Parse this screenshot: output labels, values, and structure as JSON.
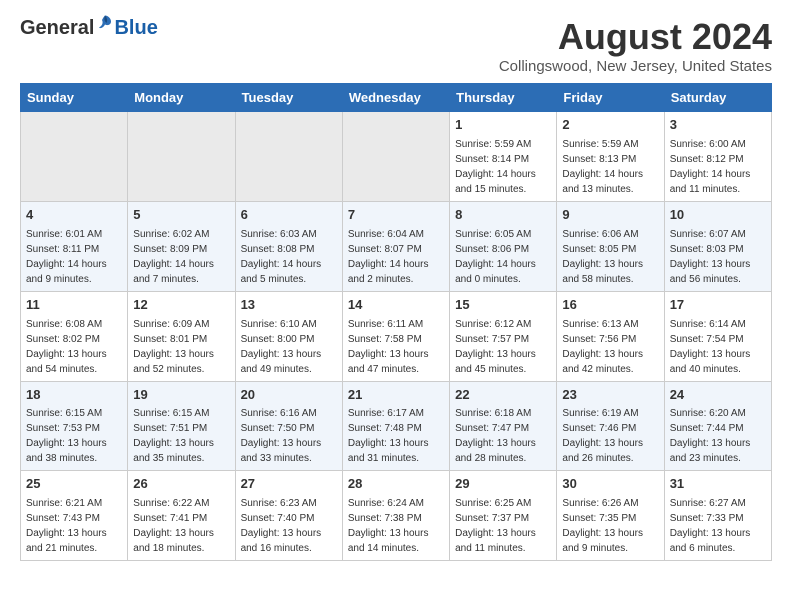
{
  "header": {
    "logo_general": "General",
    "logo_blue": "Blue",
    "month_title": "August 2024",
    "location": "Collingswood, New Jersey, United States"
  },
  "weekdays": [
    "Sunday",
    "Monday",
    "Tuesday",
    "Wednesday",
    "Thursday",
    "Friday",
    "Saturday"
  ],
  "weeks": [
    [
      {
        "day": "",
        "info": ""
      },
      {
        "day": "",
        "info": ""
      },
      {
        "day": "",
        "info": ""
      },
      {
        "day": "",
        "info": ""
      },
      {
        "day": "1",
        "info": "Sunrise: 5:59 AM\nSunset: 8:14 PM\nDaylight: 14 hours\nand 15 minutes."
      },
      {
        "day": "2",
        "info": "Sunrise: 5:59 AM\nSunset: 8:13 PM\nDaylight: 14 hours\nand 13 minutes."
      },
      {
        "day": "3",
        "info": "Sunrise: 6:00 AM\nSunset: 8:12 PM\nDaylight: 14 hours\nand 11 minutes."
      }
    ],
    [
      {
        "day": "4",
        "info": "Sunrise: 6:01 AM\nSunset: 8:11 PM\nDaylight: 14 hours\nand 9 minutes."
      },
      {
        "day": "5",
        "info": "Sunrise: 6:02 AM\nSunset: 8:09 PM\nDaylight: 14 hours\nand 7 minutes."
      },
      {
        "day": "6",
        "info": "Sunrise: 6:03 AM\nSunset: 8:08 PM\nDaylight: 14 hours\nand 5 minutes."
      },
      {
        "day": "7",
        "info": "Sunrise: 6:04 AM\nSunset: 8:07 PM\nDaylight: 14 hours\nand 2 minutes."
      },
      {
        "day": "8",
        "info": "Sunrise: 6:05 AM\nSunset: 8:06 PM\nDaylight: 14 hours\nand 0 minutes."
      },
      {
        "day": "9",
        "info": "Sunrise: 6:06 AM\nSunset: 8:05 PM\nDaylight: 13 hours\nand 58 minutes."
      },
      {
        "day": "10",
        "info": "Sunrise: 6:07 AM\nSunset: 8:03 PM\nDaylight: 13 hours\nand 56 minutes."
      }
    ],
    [
      {
        "day": "11",
        "info": "Sunrise: 6:08 AM\nSunset: 8:02 PM\nDaylight: 13 hours\nand 54 minutes."
      },
      {
        "day": "12",
        "info": "Sunrise: 6:09 AM\nSunset: 8:01 PM\nDaylight: 13 hours\nand 52 minutes."
      },
      {
        "day": "13",
        "info": "Sunrise: 6:10 AM\nSunset: 8:00 PM\nDaylight: 13 hours\nand 49 minutes."
      },
      {
        "day": "14",
        "info": "Sunrise: 6:11 AM\nSunset: 7:58 PM\nDaylight: 13 hours\nand 47 minutes."
      },
      {
        "day": "15",
        "info": "Sunrise: 6:12 AM\nSunset: 7:57 PM\nDaylight: 13 hours\nand 45 minutes."
      },
      {
        "day": "16",
        "info": "Sunrise: 6:13 AM\nSunset: 7:56 PM\nDaylight: 13 hours\nand 42 minutes."
      },
      {
        "day": "17",
        "info": "Sunrise: 6:14 AM\nSunset: 7:54 PM\nDaylight: 13 hours\nand 40 minutes."
      }
    ],
    [
      {
        "day": "18",
        "info": "Sunrise: 6:15 AM\nSunset: 7:53 PM\nDaylight: 13 hours\nand 38 minutes."
      },
      {
        "day": "19",
        "info": "Sunrise: 6:15 AM\nSunset: 7:51 PM\nDaylight: 13 hours\nand 35 minutes."
      },
      {
        "day": "20",
        "info": "Sunrise: 6:16 AM\nSunset: 7:50 PM\nDaylight: 13 hours\nand 33 minutes."
      },
      {
        "day": "21",
        "info": "Sunrise: 6:17 AM\nSunset: 7:48 PM\nDaylight: 13 hours\nand 31 minutes."
      },
      {
        "day": "22",
        "info": "Sunrise: 6:18 AM\nSunset: 7:47 PM\nDaylight: 13 hours\nand 28 minutes."
      },
      {
        "day": "23",
        "info": "Sunrise: 6:19 AM\nSunset: 7:46 PM\nDaylight: 13 hours\nand 26 minutes."
      },
      {
        "day": "24",
        "info": "Sunrise: 6:20 AM\nSunset: 7:44 PM\nDaylight: 13 hours\nand 23 minutes."
      }
    ],
    [
      {
        "day": "25",
        "info": "Sunrise: 6:21 AM\nSunset: 7:43 PM\nDaylight: 13 hours\nand 21 minutes."
      },
      {
        "day": "26",
        "info": "Sunrise: 6:22 AM\nSunset: 7:41 PM\nDaylight: 13 hours\nand 18 minutes."
      },
      {
        "day": "27",
        "info": "Sunrise: 6:23 AM\nSunset: 7:40 PM\nDaylight: 13 hours\nand 16 minutes."
      },
      {
        "day": "28",
        "info": "Sunrise: 6:24 AM\nSunset: 7:38 PM\nDaylight: 13 hours\nand 14 minutes."
      },
      {
        "day": "29",
        "info": "Sunrise: 6:25 AM\nSunset: 7:37 PM\nDaylight: 13 hours\nand 11 minutes."
      },
      {
        "day": "30",
        "info": "Sunrise: 6:26 AM\nSunset: 7:35 PM\nDaylight: 13 hours\nand 9 minutes."
      },
      {
        "day": "31",
        "info": "Sunrise: 6:27 AM\nSunset: 7:33 PM\nDaylight: 13 hours\nand 6 minutes."
      }
    ]
  ]
}
